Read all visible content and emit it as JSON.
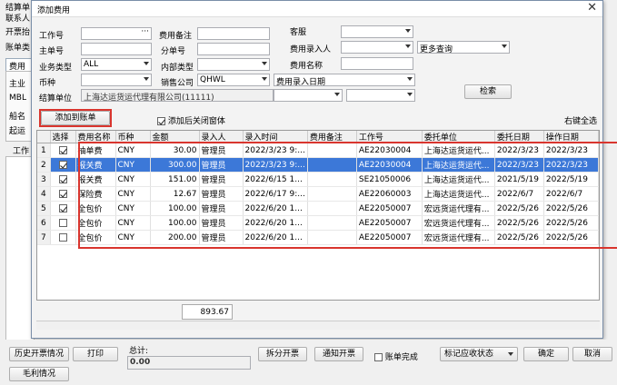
{
  "background": {
    "labels": [
      "结算单",
      "联系人",
      "开票抬",
      "账单类",
      "主业",
      "MBL",
      "船名",
      "起运",
      "工作"
    ],
    "tab": "费用"
  },
  "dialog": {
    "title": "添加费用",
    "close_glyph": "✕",
    "form": {
      "job_no_label": "工作号",
      "job_no_value": "",
      "ellipsis": "···",
      "fee_note_label": "费用备注",
      "fee_note_value": "",
      "customer_service_label": "客服",
      "customer_service_value": "",
      "master_no_label": "主单号",
      "master_no_value": "",
      "sub_no_label": "分单号",
      "sub_no_value": "",
      "fee_entry_person_label": "费用录入人",
      "fee_entry_person_value": "",
      "more_query_value": "更多查询",
      "business_type_label": "业务类型",
      "business_type_value": "ALL",
      "internal_type_label": "内部类型",
      "internal_type_value": "",
      "fee_name_label": "费用名称",
      "fee_name_value": "",
      "currency_label": "币种",
      "currency_value": "",
      "sales_company_label": "销售公司",
      "sales_company_value": "QHWL",
      "fee_entry_date_value": "费用录入日期",
      "settle_unit_label": "结算单位",
      "settle_unit_value": "上海达运货运代理有限公司(11111)",
      "date_from_value": "",
      "date_to_value": "",
      "search_label": "检索"
    },
    "add_to_bill_label": "添加到账单",
    "close_after_add_label": "添加后关闭窗体",
    "close_after_add_checked": true,
    "right_select_all_label": "右键全选",
    "table": {
      "headers": [
        "",
        "选择",
        "费用名称",
        "币种",
        "金额",
        "录入人",
        "录入时间",
        "费用备注",
        "工作号",
        "委托单位",
        "委托日期",
        "操作日期"
      ],
      "rows": [
        {
          "n": "1",
          "checked": true,
          "name": "抽单费",
          "cur": "CNY",
          "amount": "30.00",
          "by": "管理员",
          "time": "2022/3/23 9:...",
          "note": "",
          "job": "AE22030004",
          "unit": "上海达运货运代...",
          "date": "2022/3/23",
          "op": "2022/3/23",
          "selected": false
        },
        {
          "n": "2",
          "checked": true,
          "name": "报关费",
          "cur": "CNY",
          "amount": "300.00",
          "by": "管理员",
          "time": "2022/3/23 9:...",
          "note": "",
          "job": "AE22030004",
          "unit": "上海达运货运代...",
          "date": "2022/3/23",
          "op": "2022/3/23",
          "selected": true
        },
        {
          "n": "3",
          "checked": true,
          "name": "报关费",
          "cur": "CNY",
          "amount": "151.00",
          "by": "管理员",
          "time": "2022/6/15 1...",
          "note": "",
          "job": "SE21050006",
          "unit": "上海达运货运代...",
          "date": "2021/5/19",
          "op": "2022/5/19",
          "selected": false
        },
        {
          "n": "4",
          "checked": true,
          "name": "保险费",
          "cur": "CNY",
          "amount": "12.67",
          "by": "管理员",
          "time": "2022/6/17 9:...",
          "note": "",
          "job": "AE22060003",
          "unit": "上海达运货运代...",
          "date": "2022/6/7",
          "op": "2022/6/7",
          "selected": false
        },
        {
          "n": "5",
          "checked": true,
          "name": "全包价",
          "cur": "CNY",
          "amount": "100.00",
          "by": "管理员",
          "time": "2022/6/20 1...",
          "note": "",
          "job": "AE22050007",
          "unit": "宏远货运代理有...",
          "date": "2022/5/26",
          "op": "2022/5/26",
          "selected": false
        },
        {
          "n": "6",
          "checked": false,
          "name": "全包价",
          "cur": "CNY",
          "amount": "100.00",
          "by": "管理员",
          "time": "2022/6/20 1...",
          "note": "",
          "job": "AE22050007",
          "unit": "宏远货运代理有...",
          "date": "2022/5/26",
          "op": "2022/5/26",
          "selected": false
        },
        {
          "n": "7",
          "checked": false,
          "name": "全包价",
          "cur": "CNY",
          "amount": "200.00",
          "by": "管理员",
          "time": "2022/6/20 1...",
          "note": "",
          "job": "AE22050007",
          "unit": "宏远货运代理有...",
          "date": "2022/5/26",
          "op": "2022/5/26",
          "selected": false
        }
      ]
    },
    "total_amount": "893.67"
  },
  "bottom": {
    "history_invoice_label": "历史开票情况",
    "print_label": "打印",
    "total_label": "总计:",
    "total_value": "0.00",
    "split_invoice_label": "拆分开票",
    "notify_invoice_label": "通知开票",
    "bill_complete_label": "账单完成",
    "mark_status_label": "标记应收状态",
    "confirm_label": "确定",
    "cancel_label": "取消",
    "gross_profit_label": "毛利情况"
  },
  "colors": {
    "highlight": "#d9352e",
    "selection": "#3c78d8"
  }
}
